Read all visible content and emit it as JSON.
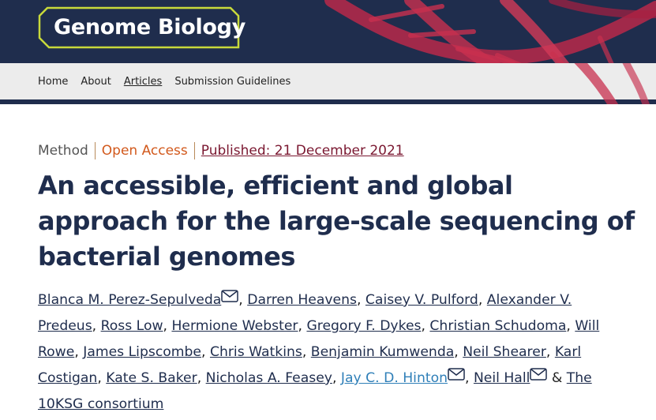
{
  "journal": {
    "name": "Genome Biology"
  },
  "nav": {
    "items": [
      {
        "label": "Home",
        "active": false
      },
      {
        "label": "About",
        "active": false
      },
      {
        "label": "Articles",
        "active": true
      },
      {
        "label": "Submission Guidelines",
        "active": false
      }
    ]
  },
  "article": {
    "type": "Method",
    "access": "Open Access",
    "published": "Published: 21 December 2021",
    "title": "An accessible, efficient and global approach for the large-scale sequencing of bacterial genomes",
    "authors": [
      {
        "name": "Blanca M. Perez-Sepulveda",
        "email_icon": true,
        "visited": false
      },
      {
        "name": "Darren Heavens",
        "email_icon": false,
        "visited": false
      },
      {
        "name": "Caisey V. Pulford",
        "email_icon": false,
        "visited": false
      },
      {
        "name": "Alexander V. Predeus",
        "email_icon": false,
        "visited": false
      },
      {
        "name": "Ross Low",
        "email_icon": false,
        "visited": false
      },
      {
        "name": "Hermione Webster",
        "email_icon": false,
        "visited": false
      },
      {
        "name": "Gregory F. Dykes",
        "email_icon": false,
        "visited": false
      },
      {
        "name": "Christian Schudoma",
        "email_icon": false,
        "visited": false
      },
      {
        "name": "Will Rowe",
        "email_icon": false,
        "visited": false
      },
      {
        "name": "James Lipscombe",
        "email_icon": false,
        "visited": false
      },
      {
        "name": "Chris Watkins",
        "email_icon": false,
        "visited": false
      },
      {
        "name": "Benjamin Kumwenda",
        "email_icon": false,
        "visited": false
      },
      {
        "name": "Neil Shearer",
        "email_icon": false,
        "visited": false
      },
      {
        "name": "Karl Costigan",
        "email_icon": false,
        "visited": false
      },
      {
        "name": "Kate S. Baker",
        "email_icon": false,
        "visited": false
      },
      {
        "name": "Nicholas A. Feasey",
        "email_icon": false,
        "visited": false
      },
      {
        "name": "Jay C. D. Hinton",
        "email_icon": true,
        "visited": true
      },
      {
        "name": "Neil Hall",
        "email_icon": true,
        "visited": false
      },
      {
        "name": "The 10KSG consortium",
        "email_icon": false,
        "visited": false
      }
    ],
    "author_separator": ",",
    "last_author_joiner": "&"
  },
  "icons": {
    "email": "envelope-icon",
    "logo_frame": "hexagon-frame"
  },
  "colors": {
    "header_bg": "#1f2d4d",
    "logo_border": "#c8d93b",
    "dna": "#c8304f",
    "open_access": "#d2591c",
    "published_link": "#7a1730",
    "title": "#1f2d4d",
    "visited_author": "#2f7fb8"
  }
}
